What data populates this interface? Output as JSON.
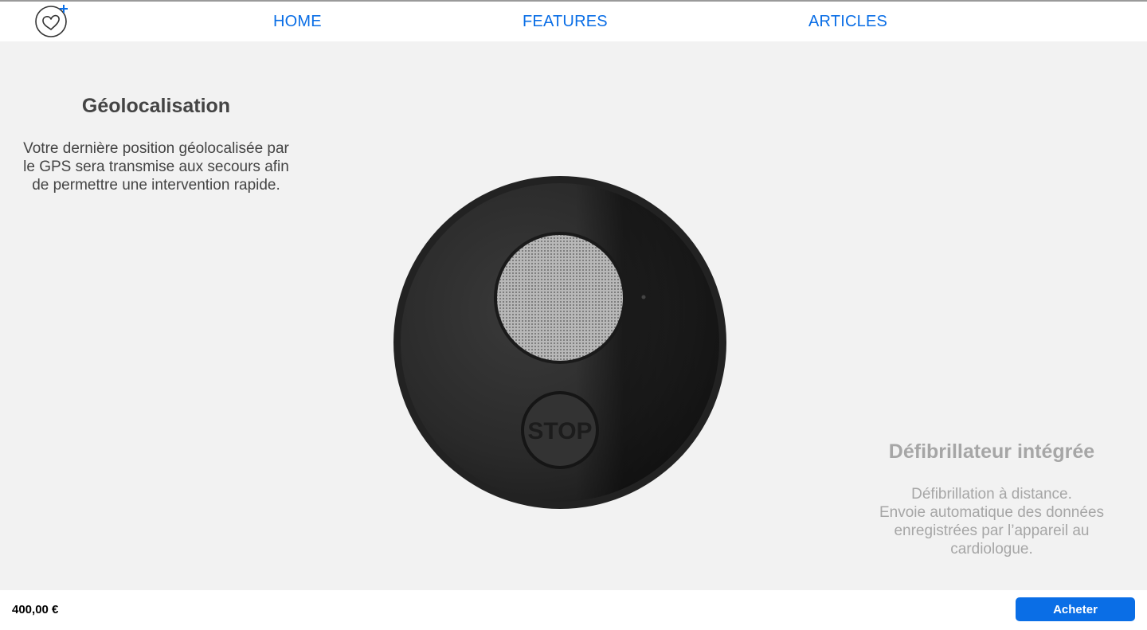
{
  "nav": {
    "home": "HOME",
    "features": "FEATURES",
    "articles": "ARTICLES"
  },
  "features": {
    "geolocation": {
      "title": "Géolocalisation",
      "description": "Votre dernière position géolocalisée par le GPS sera transmise aux secours afin de permettre une intervention rapide."
    },
    "defibrillator": {
      "title": "Défibrillateur intégrée",
      "description_lines": [
        "Défibrillation à distance.",
        "Envoie automatique des données enregistrées par l’appareil au cardiologue."
      ]
    }
  },
  "device": {
    "stop_label": "STOP"
  },
  "footer": {
    "price": "400,00 €",
    "buy_label": "Acheter"
  },
  "colors": {
    "accent": "#0a6ee6",
    "background": "#f2f2f2",
    "device_body": "#2b2b2b"
  },
  "icons": {
    "logo": "heart-plus-logo-icon"
  }
}
